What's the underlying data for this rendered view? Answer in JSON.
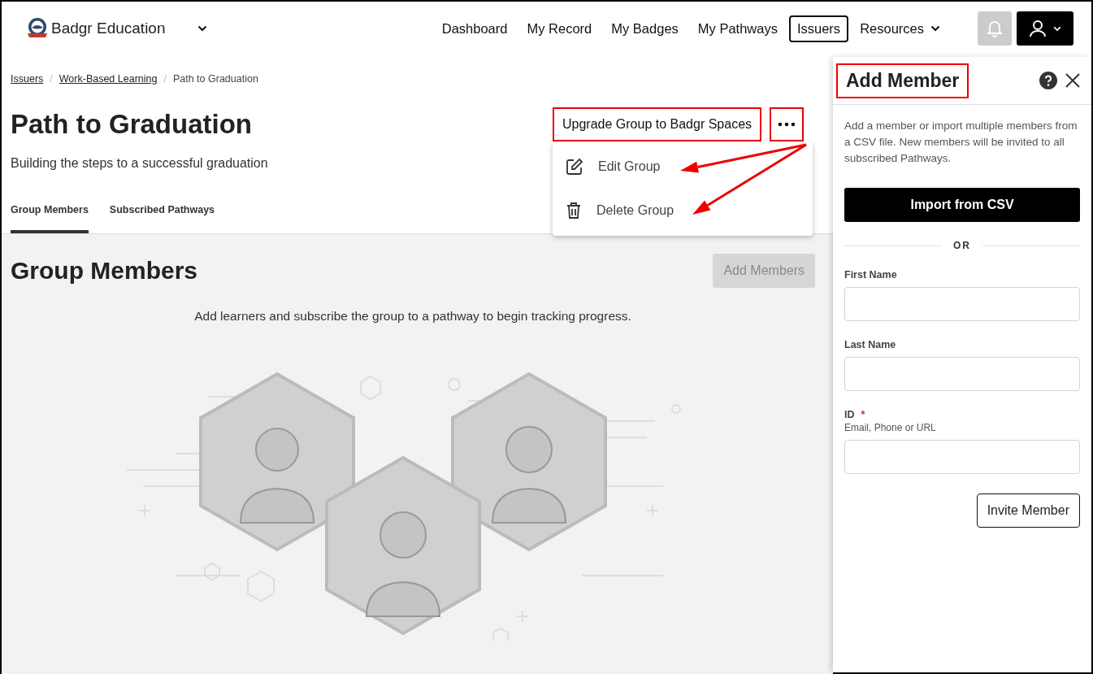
{
  "header": {
    "brand": "Badgr Education",
    "nav": [
      {
        "label": "Dashboard",
        "selected": false,
        "dropdown": false
      },
      {
        "label": "My Record",
        "selected": false,
        "dropdown": false
      },
      {
        "label": "My Badges",
        "selected": false,
        "dropdown": false
      },
      {
        "label": "My Pathways",
        "selected": false,
        "dropdown": false
      },
      {
        "label": "Issuers",
        "selected": true,
        "dropdown": false
      },
      {
        "label": "Resources",
        "selected": false,
        "dropdown": true
      }
    ]
  },
  "breadcrumb": [
    {
      "label": "Issuers",
      "kind": "link"
    },
    {
      "label": "/",
      "kind": "separator"
    },
    {
      "label": "Work-Based Learning",
      "kind": "link"
    },
    {
      "label": "/",
      "kind": "separator"
    },
    {
      "label": "Path to Graduation",
      "kind": "current"
    }
  ],
  "page": {
    "title": "Path to Graduation",
    "subtitle": "Building the steps to a successful graduation",
    "upgrade_button": {
      "label": "Upgrade Group to Badgr Spaces",
      "highlighted": true
    },
    "more_button": {
      "highlighted": true
    },
    "menu": [
      {
        "label": "Edit Group",
        "kind": "edit",
        "annotated": true
      },
      {
        "label": "Delete Group",
        "kind": "delete",
        "annotated": true
      }
    ]
  },
  "tabs": [
    {
      "label": "Group Members",
      "selected": true
    },
    {
      "label": "Subscribed Pathways",
      "selected": false
    }
  ],
  "section": {
    "title": "Group Members",
    "button": {
      "label": "Add Members",
      "disabled": true
    },
    "empty_text": "Add learners and subscribe the group to a pathway to begin tracking progress."
  },
  "panel": {
    "title": "Add Member",
    "highlighted": true,
    "description": "Add a member or import multiple members from a CSV file. New members will be invited to all subscribed Pathways.",
    "import_button": "Import from CSV",
    "divider": "OR",
    "fields": [
      {
        "label": "First Name"
      },
      {
        "label": "Last Name"
      },
      {
        "label": "ID",
        "required_mark": "*",
        "hint": "Email, Phone or URL"
      }
    ],
    "submit": "Invite Member"
  }
}
